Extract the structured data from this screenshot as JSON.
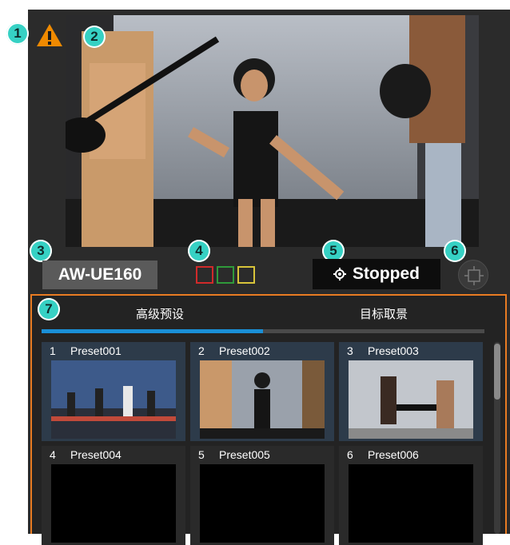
{
  "callouts": [
    "1",
    "2",
    "3",
    "4",
    "5",
    "6",
    "7"
  ],
  "camera": {
    "name": "AW-UE160",
    "status": "Stopped",
    "tally_colors": [
      "#d12a2a",
      "#2f9a3a",
      "#d8c43a"
    ]
  },
  "tabs": [
    {
      "label": "高级预设",
      "active": true
    },
    {
      "label": "目标取景",
      "active": false
    }
  ],
  "presets": [
    {
      "number": "1",
      "name": "Preset001",
      "has_thumbnail": true
    },
    {
      "number": "2",
      "name": "Preset002",
      "has_thumbnail": true
    },
    {
      "number": "3",
      "name": "Preset003",
      "has_thumbnail": true
    },
    {
      "number": "4",
      "name": "Preset004",
      "has_thumbnail": false
    },
    {
      "number": "5",
      "name": "Preset005",
      "has_thumbnail": false
    },
    {
      "number": "6",
      "name": "Preset006",
      "has_thumbnail": false
    }
  ],
  "icons": {
    "warning": "warning-icon",
    "status": "gear-icon",
    "fullscreen": "fullscreen-icon"
  },
  "colors": {
    "callout": "#36d1c4",
    "highlight_border": "#e87b22",
    "tab_indicator": "#1a8fd6",
    "warning": "#f08a00"
  }
}
